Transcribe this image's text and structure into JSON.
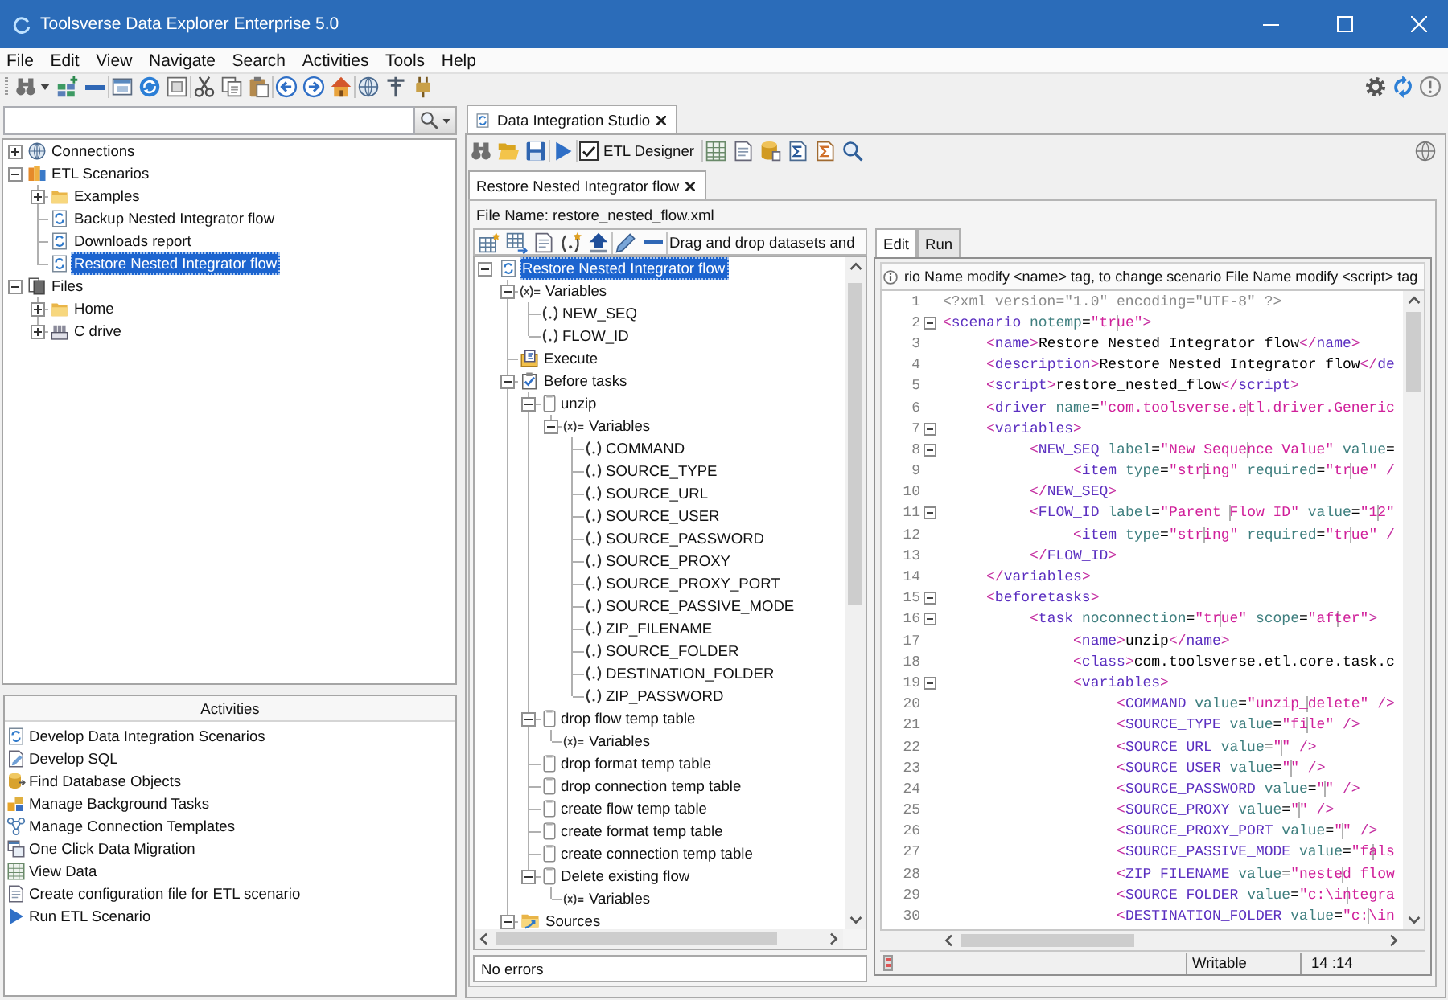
{
  "window": {
    "title": "Toolsverse Data Explorer Enterprise 5.0"
  },
  "menu": [
    "File",
    "Edit",
    "View",
    "Navigate",
    "Search",
    "Activities",
    "Tools",
    "Help"
  ],
  "navigator": {
    "tree": [
      {
        "label": "Connections",
        "kind": "connections",
        "selected": false,
        "expanded": false
      },
      {
        "label": "ETL Scenarios",
        "kind": "scenarios",
        "selected": false,
        "expanded": true,
        "children": [
          {
            "label": "Examples",
            "kind": "folder",
            "selected": false,
            "expanded": false
          },
          {
            "label": "Backup Nested Integrator flow",
            "kind": "scenario",
            "selected": false
          },
          {
            "label": "Downloads report",
            "kind": "scenario",
            "selected": false
          },
          {
            "label": "Restore Nested Integrator flow",
            "kind": "scenario",
            "selected": true
          }
        ]
      },
      {
        "label": "Files",
        "kind": "files",
        "selected": false,
        "expanded": true,
        "children": [
          {
            "label": "Home",
            "kind": "folder",
            "selected": false,
            "expanded": false
          },
          {
            "label": "C drive",
            "kind": "drive",
            "selected": false,
            "expanded": false
          }
        ]
      }
    ]
  },
  "activities": {
    "title": "Activities",
    "items": [
      "Develop Data Integration Scenarios",
      "Develop SQL",
      "Find Database Objects",
      "Manage Background Tasks",
      "Manage Connection Templates",
      "One Click Data Migration",
      "View Data",
      "Create configuration file for ETL scenario",
      "Run ETL Scenario"
    ]
  },
  "studio": {
    "tabs": [
      {
        "label": "Data Integration Studio",
        "selected": true
      }
    ],
    "toolbar": {
      "etl_designer": {
        "label": "ETL Designer",
        "checked": true
      }
    },
    "documents": [
      {
        "label": "Restore Nested Integrator flow",
        "selected": true
      }
    ],
    "file_name": "File Name: restore_nested_flow.xml",
    "designer": {
      "hint": "Drag and drop datasets and",
      "tree": [
        {
          "label": "Restore Nested Integrator flow",
          "kind": "scenario",
          "selected": true,
          "expanded": true,
          "children": [
            {
              "label": "Variables",
              "kind": "variables",
              "selected": false,
              "expanded": true,
              "children": [
                {
                  "label": "NEW_SEQ",
                  "kind": "variable",
                  "selected": false
                },
                {
                  "label": "FLOW_ID",
                  "kind": "variable",
                  "selected": false
                }
              ]
            },
            {
              "label": "Execute",
              "kind": "execute",
              "selected": false
            },
            {
              "label": "Before tasks",
              "kind": "tasks",
              "selected": false,
              "expanded": true,
              "children": [
                {
                  "label": "unzip",
                  "kind": "task",
                  "selected": false,
                  "expanded": true,
                  "children": [
                    {
                      "label": "Variables",
                      "kind": "variables",
                      "selected": false,
                      "expanded": true,
                      "children": [
                        {
                          "label": "COMMAND",
                          "kind": "variable",
                          "selected": false
                        },
                        {
                          "label": "SOURCE_TYPE",
                          "kind": "variable",
                          "selected": false
                        },
                        {
                          "label": "SOURCE_URL",
                          "kind": "variable",
                          "selected": false
                        },
                        {
                          "label": "SOURCE_USER",
                          "kind": "variable",
                          "selected": false
                        },
                        {
                          "label": "SOURCE_PASSWORD",
                          "kind": "variable",
                          "selected": false
                        },
                        {
                          "label": "SOURCE_PROXY",
                          "kind": "variable",
                          "selected": false
                        },
                        {
                          "label": "SOURCE_PROXY_PORT",
                          "kind": "variable",
                          "selected": false
                        },
                        {
                          "label": "SOURCE_PASSIVE_MODE",
                          "kind": "variable",
                          "selected": false
                        },
                        {
                          "label": "ZIP_FILENAME",
                          "kind": "variable",
                          "selected": false
                        },
                        {
                          "label": "SOURCE_FOLDER",
                          "kind": "variable",
                          "selected": false
                        },
                        {
                          "label": "DESTINATION_FOLDER",
                          "kind": "variable",
                          "selected": false
                        },
                        {
                          "label": "ZIP_PASSWORD",
                          "kind": "variable",
                          "selected": false
                        }
                      ]
                    }
                  ]
                },
                {
                  "label": "drop flow temp table",
                  "kind": "task",
                  "selected": false,
                  "expanded": true,
                  "children": [
                    {
                      "label": "Variables",
                      "kind": "variables",
                      "selected": false
                    }
                  ]
                },
                {
                  "label": "drop format temp table",
                  "kind": "task",
                  "selected": false
                },
                {
                  "label": "drop connection temp table",
                  "kind": "task",
                  "selected": false
                },
                {
                  "label": "create flow temp table",
                  "kind": "task",
                  "selected": false
                },
                {
                  "label": "create format temp table",
                  "kind": "task",
                  "selected": false
                },
                {
                  "label": "create connection temp table",
                  "kind": "task",
                  "selected": false
                },
                {
                  "label": "Delete existing flow",
                  "kind": "task",
                  "selected": false,
                  "expanded": true,
                  "children": [
                    {
                      "label": "Variables",
                      "kind": "variables",
                      "selected": false
                    }
                  ]
                }
              ]
            },
            {
              "label": "Sources",
              "kind": "sources",
              "selected": false,
              "expanded": true
            }
          ]
        }
      ],
      "status": "No errors"
    },
    "editor": {
      "tabs": [
        {
          "label": "Edit",
          "selected": true
        },
        {
          "label": "Run",
          "selected": false
        }
      ],
      "info": "rio Name modify <name> tag, to change scenario File Name modify <script> tag",
      "lines": [
        {
          "number": "1",
          "text": "<?xml version=\"1.0\" encoding=\"UTF-8\" ?>",
          "collapsible": false
        },
        {
          "number": "2",
          "text": "<scenario notemp=\"true\">",
          "collapsible": true
        },
        {
          "number": "3",
          "text": "\t<name>Restore Nested Integrator flow</name>",
          "collapsible": false
        },
        {
          "number": "4",
          "text": "\t<description>Restore Nested Integrator flow</de",
          "collapsible": false
        },
        {
          "number": "5",
          "text": "\t<script>restore_nested_flow</script>",
          "collapsible": false
        },
        {
          "number": "6",
          "text": "\t<driver name=\"com.toolsverse.etl.driver.Generic",
          "collapsible": false
        },
        {
          "number": "7",
          "text": "\t<variables>",
          "collapsible": true
        },
        {
          "number": "8",
          "text": "\t\t<NEW_SEQ label=\"New Sequence Value\" value=",
          "collapsible": true
        },
        {
          "number": "9",
          "text": "\t\t\t<item type=\"string\" required=\"true\" /",
          "collapsible": false
        },
        {
          "number": "10",
          "text": "\t\t</NEW_SEQ>",
          "collapsible": false
        },
        {
          "number": "11",
          "text": "\t\t<FLOW_ID label=\"Parent Flow ID\" value=\"12\"",
          "collapsible": true
        },
        {
          "number": "12",
          "text": "\t\t\t<item type=\"string\" required=\"true\" /",
          "collapsible": false
        },
        {
          "number": "13",
          "text": "\t\t</FLOW_ID>",
          "collapsible": false
        },
        {
          "number": "14",
          "text": "\t</variables>",
          "collapsible": false
        },
        {
          "number": "15",
          "text": "\t<beforetasks>",
          "collapsible": true
        },
        {
          "number": "16",
          "text": "\t\t<task noconnection=\"true\" scope=\"after\">",
          "collapsible": true
        },
        {
          "number": "17",
          "text": "\t\t\t<name>unzip</name>",
          "collapsible": false
        },
        {
          "number": "18",
          "text": "\t\t\t<class>com.toolsverse.etl.core.task.c",
          "collapsible": false
        },
        {
          "number": "19",
          "text": "\t\t\t<variables>",
          "collapsible": true
        },
        {
          "number": "20",
          "text": "\t\t\t\t<COMMAND value=\"unzip_delete\" />",
          "collapsible": false
        },
        {
          "number": "21",
          "text": "\t\t\t\t<SOURCE_TYPE value=\"file\" />",
          "collapsible": false
        },
        {
          "number": "22",
          "text": "\t\t\t\t<SOURCE_URL value=\"\" />",
          "collapsible": false
        },
        {
          "number": "23",
          "text": "\t\t\t\t<SOURCE_USER value=\"\" />",
          "collapsible": false
        },
        {
          "number": "24",
          "text": "\t\t\t\t<SOURCE_PASSWORD value=\"\" />",
          "collapsible": false
        },
        {
          "number": "25",
          "text": "\t\t\t\t<SOURCE_PROXY value=\"\" />",
          "collapsible": false
        },
        {
          "number": "26",
          "text": "\t\t\t\t<SOURCE_PROXY_PORT value=\"\" />",
          "collapsible": false
        },
        {
          "number": "27",
          "text": "\t\t\t\t<SOURCE_PASSIVE_MODE value=\"fals",
          "collapsible": false
        },
        {
          "number": "28",
          "text": "\t\t\t\t<ZIP_FILENAME value=\"nested_flow",
          "collapsible": false
        },
        {
          "number": "29",
          "text": "\t\t\t\t<SOURCE_FOLDER value=\"c:\\integra",
          "collapsible": false
        },
        {
          "number": "30",
          "text": "\t\t\t\t<DESTINATION_FOLDER value=\"c:\\in",
          "collapsible": false
        }
      ],
      "status": {
        "mode": "Writable",
        "position": "14 :14"
      }
    }
  }
}
